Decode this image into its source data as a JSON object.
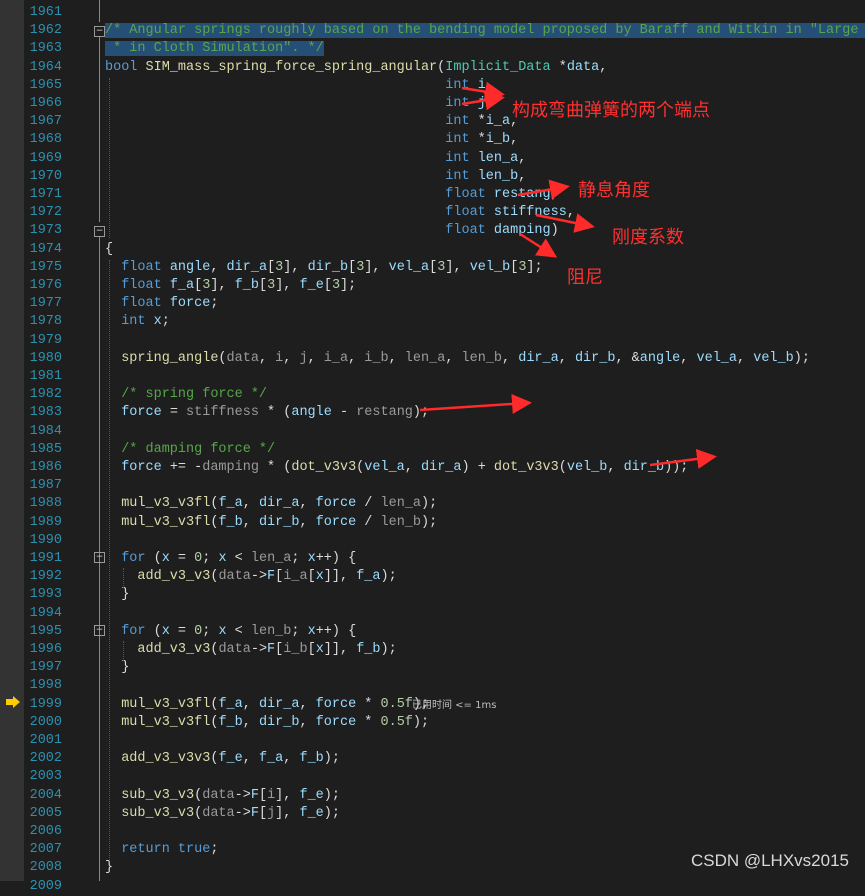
{
  "lines": [
    {
      "n": "1961",
      "html": ""
    },
    {
      "n": "1962",
      "html": "<span class='hl'><span class='c'>/* Angular springs roughly based on the bending model proposed by Baraff and Witkin in \"Large Steps</span></span>"
    },
    {
      "n": "1963",
      "html": "<span class='hl'><span class='c'> * in Cloth Simulation\". */</span></span>"
    },
    {
      "n": "1964",
      "html": "<span class='k'>bool</span> <span class='f'>SIM_mass_spring_force_spring_angular</span>(<span class='t'>Implicit_Data</span> *<span class='v'>data</span>,"
    },
    {
      "n": "1965",
      "html": "                                          <span class='k'>int</span> <span class='v'>i</span>,"
    },
    {
      "n": "1966",
      "html": "                                          <span class='k'>int</span> <span class='v'>j</span>,"
    },
    {
      "n": "1967",
      "html": "                                          <span class='k'>int</span> *<span class='v'>i_a</span>,"
    },
    {
      "n": "1968",
      "html": "                                          <span class='k'>int</span> *<span class='v'>i_b</span>,"
    },
    {
      "n": "1969",
      "html": "                                          <span class='k'>int</span> <span class='v'>len_a</span>,"
    },
    {
      "n": "1970",
      "html": "                                          <span class='k'>int</span> <span class='v'>len_b</span>,"
    },
    {
      "n": "1971",
      "html": "                                          <span class='k'>float</span> <span class='v'>restang</span>,"
    },
    {
      "n": "1972",
      "html": "                                          <span class='k'>float</span> <span class='v'>stiffness</span>,"
    },
    {
      "n": "1973",
      "html": "                                          <span class='k'>float</span> <span class='v'>damping</span>)"
    },
    {
      "n": "1974",
      "html": "{"
    },
    {
      "n": "1975",
      "html": "  <span class='k'>float</span> <span class='v'>angle</span>, <span class='v'>dir_a</span>[<span class='n'>3</span>], <span class='v'>dir_b</span>[<span class='n'>3</span>], <span class='v'>vel_a</span>[<span class='n'>3</span>], <span class='v'>vel_b</span>[<span class='n'>3</span>];"
    },
    {
      "n": "1976",
      "html": "  <span class='k'>float</span> <span class='v'>f_a</span>[<span class='n'>3</span>], <span class='v'>f_b</span>[<span class='n'>3</span>], <span class='v'>f_e</span>[<span class='n'>3</span>];"
    },
    {
      "n": "1977",
      "html": "  <span class='k'>float</span> <span class='v'>force</span>;"
    },
    {
      "n": "1978",
      "html": "  <span class='k'>int</span> <span class='v'>x</span>;"
    },
    {
      "n": "1979",
      "html": ""
    },
    {
      "n": "1980",
      "html": "  <span class='f'>spring_angle</span>(<span class='p'>data</span>, <span class='p'>i</span>, <span class='p'>j</span>, <span class='p'>i_a</span>, <span class='p'>i_b</span>, <span class='p'>len_a</span>, <span class='p'>len_b</span>, <span class='v'>dir_a</span>, <span class='v'>dir_b</span>, &amp;<span class='v'>angle</span>, <span class='v'>vel_a</span>, <span class='v'>vel_b</span>);"
    },
    {
      "n": "1981",
      "html": ""
    },
    {
      "n": "1982",
      "html": "  <span class='c'>/* spring force */</span>"
    },
    {
      "n": "1983",
      "html": "  <span class='v'>force</span> = <span class='p'>stiffness</span> * (<span class='v'>angle</span> - <span class='p'>restang</span>);"
    },
    {
      "n": "1984",
      "html": ""
    },
    {
      "n": "1985",
      "html": "  <span class='c'>/* damping force */</span>"
    },
    {
      "n": "1986",
      "html": "  <span class='v'>force</span> += -<span class='p'>damping</span> * (<span class='f'>dot_v3v3</span>(<span class='v'>vel_a</span>, <span class='v'>dir_a</span>) + <span class='f'>dot_v3v3</span>(<span class='v'>vel_b</span>, <span class='v'>dir_b</span>));"
    },
    {
      "n": "1987",
      "html": ""
    },
    {
      "n": "1988",
      "html": "  <span class='f'>mul_v3_v3fl</span>(<span class='v'>f_a</span>, <span class='v'>dir_a</span>, <span class='v'>force</span> / <span class='p'>len_a</span>);"
    },
    {
      "n": "1989",
      "html": "  <span class='f'>mul_v3_v3fl</span>(<span class='v'>f_b</span>, <span class='v'>dir_b</span>, <span class='v'>force</span> / <span class='p'>len_b</span>);"
    },
    {
      "n": "1990",
      "html": ""
    },
    {
      "n": "1991",
      "html": "  <span class='k'>for</span> (<span class='v'>x</span> = <span class='n'>0</span>; <span class='v'>x</span> &lt; <span class='p'>len_a</span>; <span class='v'>x</span>++) {"
    },
    {
      "n": "1992",
      "html": "    <span class='f'>add_v3_v3</span>(<span class='p'>data</span>-&gt;<span class='v'>F</span>[<span class='p'>i_a</span>[<span class='v'>x</span>]], <span class='v'>f_a</span>);"
    },
    {
      "n": "1993",
      "html": "  }"
    },
    {
      "n": "1994",
      "html": ""
    },
    {
      "n": "1995",
      "html": "  <span class='k'>for</span> (<span class='v'>x</span> = <span class='n'>0</span>; <span class='v'>x</span> &lt; <span class='p'>len_b</span>; <span class='v'>x</span>++) {"
    },
    {
      "n": "1996",
      "html": "    <span class='f'>add_v3_v3</span>(<span class='p'>data</span>-&gt;<span class='v'>F</span>[<span class='p'>i_b</span>[<span class='v'>x</span>]], <span class='v'>f_b</span>);"
    },
    {
      "n": "1997",
      "html": "  }"
    },
    {
      "n": "1998",
      "html": ""
    },
    {
      "n": "1999",
      "html": "  <span class='f'>mul_v3_v3fl</span>(<span class='v'>f_a</span>, <span class='v'>dir_a</span>, <span class='v'>force</span> * <span class='n'>0.5f</span>);"
    },
    {
      "n": "2000",
      "html": "  <span class='f'>mul_v3_v3fl</span>(<span class='v'>f_b</span>, <span class='v'>dir_b</span>, <span class='v'>force</span> * <span class='n'>0.5f</span>);"
    },
    {
      "n": "2001",
      "html": ""
    },
    {
      "n": "2002",
      "html": "  <span class='f'>add_v3_v3v3</span>(<span class='v'>f_e</span>, <span class='v'>f_a</span>, <span class='v'>f_b</span>);"
    },
    {
      "n": "2003",
      "html": ""
    },
    {
      "n": "2004",
      "html": "  <span class='f'>sub_v3_v3</span>(<span class='p'>data</span>-&gt;<span class='v'>F</span>[<span class='p'>i</span>], <span class='v'>f_e</span>);"
    },
    {
      "n": "2005",
      "html": "  <span class='f'>sub_v3_v3</span>(<span class='p'>data</span>-&gt;<span class='v'>F</span>[<span class='p'>j</span>], <span class='v'>f_e</span>);"
    },
    {
      "n": "2006",
      "html": ""
    },
    {
      "n": "2007",
      "html": "  <span class='k'>return</span> <span class='k'>true</span>;"
    },
    {
      "n": "2008",
      "html": "}"
    },
    {
      "n": "2009",
      "html": ""
    }
  ],
  "annotations": {
    "endpoints": "构成弯曲弹簧的两个端点",
    "rest_angle": "静息角度",
    "stiffness": "刚度系数",
    "damping": "阻尼"
  },
  "elapsed_hint": "已用时间 <= 1ms",
  "watermark": "CSDN @LHXvs2015",
  "colors": {
    "annotation": "#ff3030",
    "background": "#1e1e1e",
    "line_number": "#2b91af"
  }
}
